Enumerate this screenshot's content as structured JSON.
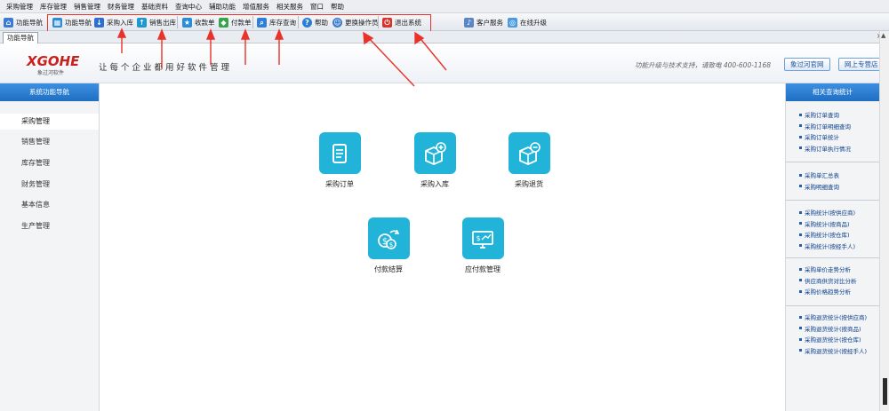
{
  "menubar": {
    "items": [
      "采购管理",
      "库存管理",
      "销售管理",
      "财务管理",
      "基础资料",
      "查询中心",
      "辅助功能",
      "增值服务",
      "相关服务",
      "窗口",
      "帮助"
    ]
  },
  "toolbar": {
    "left_label": "功能导航",
    "buttons": [
      "功能导航",
      "采购入库",
      "销售出库",
      "收款单",
      "付款单",
      "库存查询",
      "帮助",
      "更换操作员",
      "退出系统"
    ],
    "extra_buttons": [
      "客户服务",
      "在线升级"
    ]
  },
  "tab": {
    "label": "功能导航"
  },
  "header": {
    "logo": "XGOHE",
    "logo_sub": "象过河软件",
    "slogan": "让每个企业都用好软件管理",
    "hotline": "功能升级与技术支持，请致电 400-600-1168",
    "btn_contact": "象过河官网",
    "btn_forum": "网上专营店"
  },
  "left_panel": {
    "title": "系统功能导航",
    "items": [
      "采购管理",
      "销售管理",
      "库存管理",
      "财务管理",
      "基本信息",
      "生产管理"
    ]
  },
  "main": {
    "functions": [
      {
        "label": "采购订单",
        "icon": "document-icon"
      },
      {
        "label": "采购入库",
        "icon": "box-plus-icon"
      },
      {
        "label": "采购退货",
        "icon": "box-minus-icon"
      },
      {
        "label": "付款结算",
        "icon": "money-exchange-icon"
      },
      {
        "label": "应付款管理",
        "icon": "payable-screen-icon"
      }
    ]
  },
  "right_panel": {
    "title": "相关查询统计",
    "groups": [
      [
        "采购订单查询",
        "采购订单明细查询",
        "采购订单统计",
        "采购订单执行情况"
      ],
      [
        "采购单汇总表",
        "采购明细查询"
      ],
      [
        "采购统计(按供应商)",
        "采购统计(按商品)",
        "采购统计(按仓库)",
        "采购统计(按经手人)"
      ],
      [
        "采购单价走势分析",
        "供应商供货对比分析",
        "采购价格趋势分析"
      ],
      [
        "采购退货统计(按供应商)",
        "采购退货统计(按商品)",
        "采购退货统计(按仓库)",
        "采购退货统计(按经手人)"
      ]
    ]
  },
  "colors": {
    "accent": "#22b3d8",
    "panel_header": "#1f6fc4",
    "annotation": "#e8322a",
    "logo": "#c8201c"
  }
}
